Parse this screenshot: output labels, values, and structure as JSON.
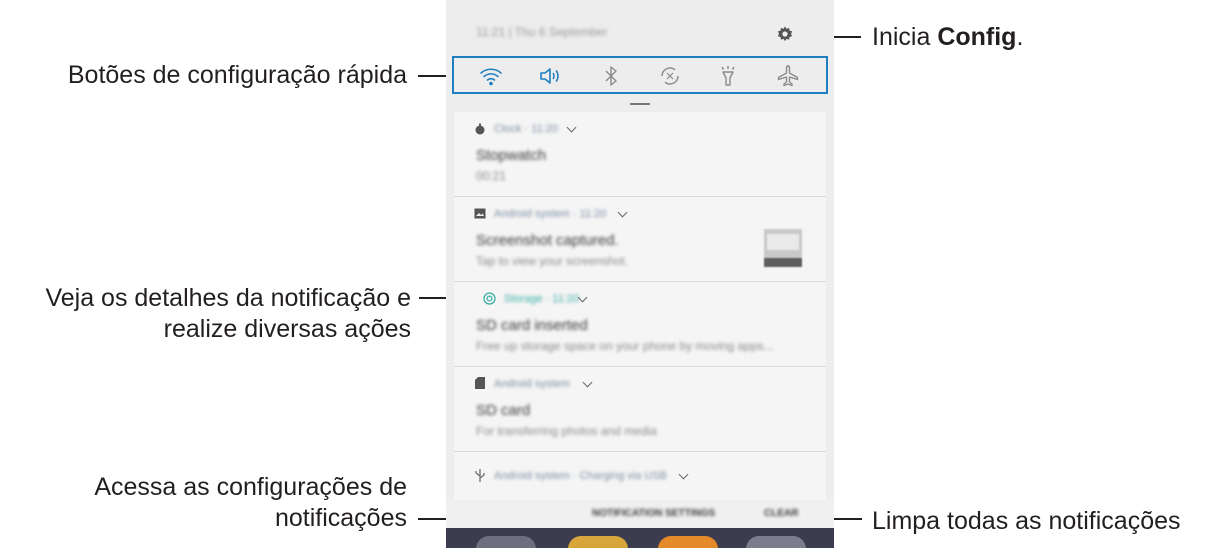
{
  "annotations": {
    "settings": {
      "prefix": "Inicia ",
      "bold": "Config",
      "suffix": "."
    },
    "quick_settings": "Botões de configuração rápida",
    "notification_details_line1": "Veja os detalhes da notificação e",
    "notification_details_line2": "realize diversas ações",
    "notification_settings_line1": "Acessa as configurações de",
    "notification_settings_line2": "notificações",
    "clear_all": "Limpa todas as notificações"
  },
  "status_bar": {
    "time_date": "11:21 | Thu 6 September"
  },
  "quick_settings": {
    "accent_color": "#1f7fc1",
    "icons": [
      "wifi-icon",
      "sound-icon",
      "bluetooth-icon",
      "auto-rotate-icon",
      "flashlight-icon",
      "airplane-mode-icon"
    ]
  },
  "notifications": [
    {
      "icon": "stopwatch-icon",
      "app": "Clock · 11:20",
      "title": "Stopwatch",
      "text": "00:21"
    },
    {
      "icon": "image-icon",
      "app": "Android system · 11:20",
      "title": "Screenshot captured.",
      "text": "Tap to view your screenshot."
    },
    {
      "icon": "storage-icon",
      "app": "Storage · 11:20",
      "title": "SD card inserted",
      "text": "Free up storage space on your phone by moving apps..."
    },
    {
      "icon": "sd-card-icon",
      "app": "Android system",
      "title": "SD card",
      "text": "For transferring photos and media"
    },
    {
      "icon": "usb-icon",
      "app": "Android system · Charging via USB",
      "title": "",
      "text": ""
    }
  ],
  "bottom_bar": {
    "notification_settings": "NOTIFICATION SETTINGS",
    "clear": "CLEAR"
  }
}
